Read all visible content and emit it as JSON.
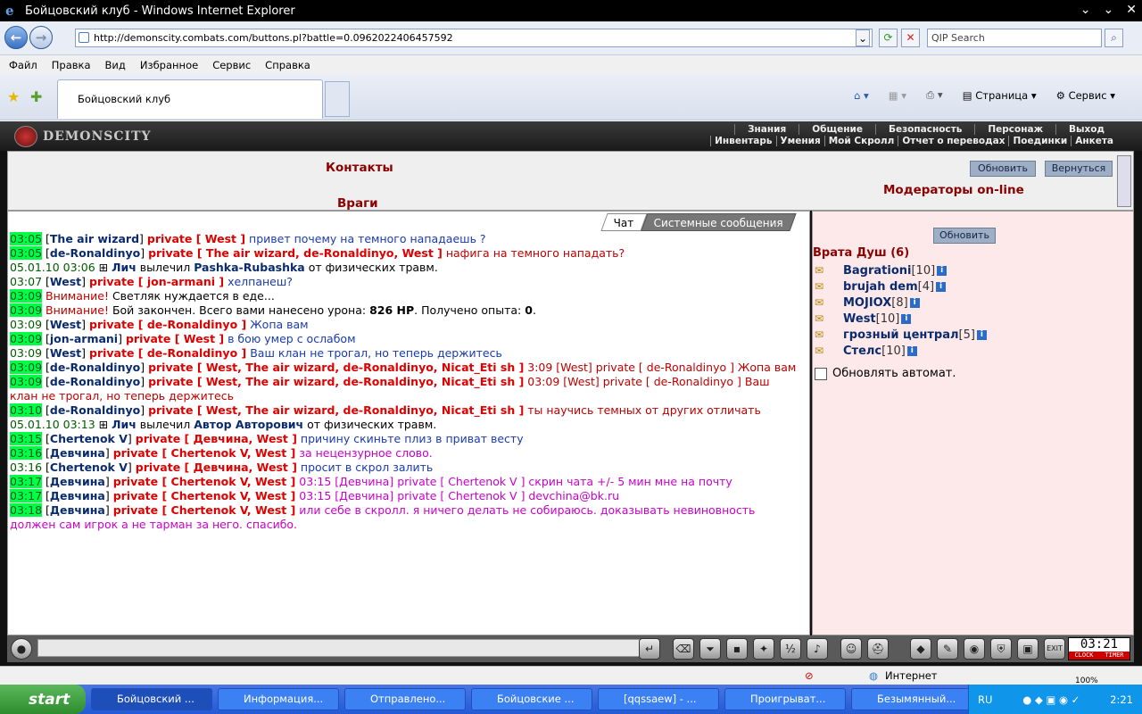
{
  "window": {
    "title": "Бойцовский клуб - Windows Internet Explorer"
  },
  "address": {
    "url": "http://demonscity.combats.com/buttons.pl?battle=0.0962022406457592",
    "search_placeholder": "QIP Search"
  },
  "menu": [
    "Файл",
    "Правка",
    "Вид",
    "Избранное",
    "Сервис",
    "Справка"
  ],
  "tab": {
    "label": "Бойцовский клуб"
  },
  "commands": {
    "page": "Страница",
    "tools": "Сервис"
  },
  "game": {
    "logo": "DEMONSCITY",
    "menu_top": [
      "Знания",
      "Общение",
      "Безопасность",
      "Персонаж",
      "Выход"
    ],
    "menu_bottom": [
      "Инвентарь",
      "Умения",
      "Мой Скролл",
      "Отчет о переводах",
      "Поединки",
      "Анкета"
    ],
    "contacts_title": "Контакты",
    "enemies_title": "Враги",
    "moderators_title": "Модераторы on-line",
    "refresh_label": "Обновить",
    "back_label": "Вернуться",
    "chat_tab": "Чат",
    "system_tab": "Системные сообщения",
    "users_refresh": "Обновить",
    "room": "Врата Душ (6)",
    "auto_refresh": "Обновлять автомат.",
    "clock": "03:21",
    "clock_label1": "CLOCK",
    "clock_label2": "TIMER"
  },
  "chat": [
    [
      {
        "c": "tm",
        "t": "03:05"
      },
      {
        "c": "tk",
        "t": " ["
      },
      {
        "c": "nk",
        "t": "The air wizard"
      },
      {
        "c": "tk",
        "t": "] "
      },
      {
        "c": "pr",
        "t": "private [ West ]"
      },
      {
        "c": "tb",
        "t": " привет почему на темного нападаешь ?"
      }
    ],
    [
      {
        "c": "tm",
        "t": "03:05"
      },
      {
        "c": "tk",
        "t": " ["
      },
      {
        "c": "nk",
        "t": "de-Ronaldinyo"
      },
      {
        "c": "tk",
        "t": "] "
      },
      {
        "c": "pr",
        "t": "private [ The air wizard, de-Ronaldinyo, West ]"
      },
      {
        "c": "tr",
        "t": " нафига на темного нападать?"
      }
    ],
    [
      {
        "c": "tp",
        "t": "05.01.10 03:06"
      },
      {
        "c": "tk",
        "t": " ⊞ "
      },
      {
        "c": "nk",
        "t": "Лич"
      },
      {
        "c": "tk",
        "t": " вылечил "
      },
      {
        "c": "nk",
        "t": "Pashka-Rubashka"
      },
      {
        "c": "tk",
        "t": " от физических травм."
      }
    ],
    [
      {
        "c": "tp",
        "t": "03:07"
      },
      {
        "c": "tk",
        "t": " ["
      },
      {
        "c": "nk",
        "t": "West"
      },
      {
        "c": "tk",
        "t": "] "
      },
      {
        "c": "pr",
        "t": "private [ jon-armani ]"
      },
      {
        "c": "tb",
        "t": " хелпанеш?"
      }
    ],
    [
      {
        "c": "tm",
        "t": "03:09"
      },
      {
        "c": "tr",
        "t": " Внимание!"
      },
      {
        "c": "tk",
        "t": " Светляк нуждается в еде..."
      }
    ],
    [
      {
        "c": "tm",
        "t": "03:09"
      },
      {
        "c": "tr",
        "t": " Внимание!"
      },
      {
        "c": "tk",
        "t": " Бой закончен. Всего вами нанесено урона: "
      },
      {
        "c": "nkb",
        "t": "826 HP"
      },
      {
        "c": "tk",
        "t": ". Получено опыта: "
      },
      {
        "c": "nkb",
        "t": "0"
      },
      {
        "c": "tk",
        "t": "."
      }
    ],
    [
      {
        "c": "tp",
        "t": "03:09"
      },
      {
        "c": "tk",
        "t": " ["
      },
      {
        "c": "nk",
        "t": "West"
      },
      {
        "c": "tk",
        "t": "] "
      },
      {
        "c": "pr",
        "t": "private [ de-Ronaldinyo ]"
      },
      {
        "c": "tb",
        "t": " Жопа вам"
      }
    ],
    [
      {
        "c": "tm",
        "t": "03:09"
      },
      {
        "c": "tk",
        "t": " ["
      },
      {
        "c": "nk",
        "t": "jon-armani"
      },
      {
        "c": "tk",
        "t": "] "
      },
      {
        "c": "pr",
        "t": "private [ West ]"
      },
      {
        "c": "tb",
        "t": " в бою умер с ослабом"
      }
    ],
    [
      {
        "c": "tp",
        "t": "03:09"
      },
      {
        "c": "tk",
        "t": " ["
      },
      {
        "c": "nk",
        "t": "West"
      },
      {
        "c": "tk",
        "t": "] "
      },
      {
        "c": "pr",
        "t": "private [ de-Ronaldinyo ]"
      },
      {
        "c": "tb",
        "t": " Ваш клан не трогал, но теперь держитесь"
      }
    ],
    [
      {
        "c": "tm",
        "t": "03:09"
      },
      {
        "c": "tk",
        "t": " ["
      },
      {
        "c": "nk",
        "t": "de-Ronaldinyo"
      },
      {
        "c": "tk",
        "t": "] "
      },
      {
        "c": "pr",
        "t": "private [ West, The air wizard, de-Ronaldinyo, Nicat_Eti sh ]"
      },
      {
        "c": "tr",
        "t": " 3:09 [West] private [ de-Ronaldinyo ] Жопа вам"
      }
    ],
    [
      {
        "c": "tm",
        "t": "03:09"
      },
      {
        "c": "tk",
        "t": " ["
      },
      {
        "c": "nk",
        "t": "de-Ronaldinyo"
      },
      {
        "c": "tk",
        "t": "] "
      },
      {
        "c": "pr",
        "t": "private [ West, The air wizard, de-Ronaldinyo, Nicat_Eti sh ]"
      },
      {
        "c": "tr",
        "t": " 03:09 [West] private [ de-Ronaldinyo ] Ваш клан не трогал, но теперь держитесь"
      }
    ],
    [
      {
        "c": "tm",
        "t": "03:10"
      },
      {
        "c": "tk",
        "t": " ["
      },
      {
        "c": "nk",
        "t": "de-Ronaldinyo"
      },
      {
        "c": "tk",
        "t": "] "
      },
      {
        "c": "pr",
        "t": "private [ West, The air wizard, de-Ronaldinyo, Nicat_Eti sh ]"
      },
      {
        "c": "tr",
        "t": " ты научись темных от других отличать"
      }
    ],
    [
      {
        "c": "tp",
        "t": "05.01.10 03:13"
      },
      {
        "c": "tk",
        "t": " ⊞ "
      },
      {
        "c": "nk",
        "t": "Лич"
      },
      {
        "c": "tk",
        "t": " вылечил "
      },
      {
        "c": "nk",
        "t": "Автор Авторович"
      },
      {
        "c": "tk",
        "t": " от физических травм."
      }
    ],
    [
      {
        "c": "tm",
        "t": "03:15"
      },
      {
        "c": "tk",
        "t": " ["
      },
      {
        "c": "nk",
        "t": "Chertenok V"
      },
      {
        "c": "tk",
        "t": "] "
      },
      {
        "c": "pr",
        "t": "private [ Девчина, West ]"
      },
      {
        "c": "tb",
        "t": " причину скиньте плиз в приват весту"
      }
    ],
    [
      {
        "c": "tm",
        "t": "03:16"
      },
      {
        "c": "tk",
        "t": " ["
      },
      {
        "c": "nk",
        "t": "Девчина"
      },
      {
        "c": "tk",
        "t": "] "
      },
      {
        "c": "pr",
        "t": "private [ Chertenok V, West ]"
      },
      {
        "c": "tv",
        "t": " за нецензурное слово."
      }
    ],
    [
      {
        "c": "tp",
        "t": "03:16"
      },
      {
        "c": "tk",
        "t": " ["
      },
      {
        "c": "nk",
        "t": "Chertenok V"
      },
      {
        "c": "tk",
        "t": "] "
      },
      {
        "c": "pr",
        "t": "private [ Девчина, West ]"
      },
      {
        "c": "tb",
        "t": " просит в скрол залить"
      }
    ],
    [
      {
        "c": "tm",
        "t": "03:17"
      },
      {
        "c": "tk",
        "t": " ["
      },
      {
        "c": "nk",
        "t": "Девчина"
      },
      {
        "c": "tk",
        "t": "] "
      },
      {
        "c": "pr",
        "t": "private [ Chertenok V, West ]"
      },
      {
        "c": "tv",
        "t": " 03:15 [Девчина] private [ Chertenok V ] скрин чата +/- 5 мин мне на почту"
      }
    ],
    [
      {
        "c": "tm",
        "t": "03:17"
      },
      {
        "c": "tk",
        "t": " ["
      },
      {
        "c": "nk",
        "t": "Девчина"
      },
      {
        "c": "tk",
        "t": "] "
      },
      {
        "c": "pr",
        "t": "private [ Chertenok V, West ]"
      },
      {
        "c": "tv",
        "t": " 03:15 [Девчина] private [ Chertenok V ] devchina@bk.ru"
      }
    ],
    [
      {
        "c": "tm",
        "t": "03:18"
      },
      {
        "c": "tk",
        "t": " ["
      },
      {
        "c": "nk",
        "t": "Девчина"
      },
      {
        "c": "tk",
        "t": "] "
      },
      {
        "c": "pr",
        "t": "private [ Chertenok V, West ]"
      },
      {
        "c": "tv",
        "t": " или себе в скролл. я ничего делать не собираюсь. доказывать невиновность должен сам игрок а не тарман за него. спасибо."
      }
    ]
  ],
  "users": [
    {
      "name": "Bagrationi",
      "level": "[10]"
    },
    {
      "name": "brujah dem",
      "level": "[4]"
    },
    {
      "name": "MOJIOX",
      "level": "[8]"
    },
    {
      "name": "West",
      "level": "[10]"
    },
    {
      "name": "грозный централ",
      "level": "[5]"
    },
    {
      "name": "Стелс",
      "level": "[10]"
    }
  ],
  "status": {
    "zone": "Интернет",
    "zoom": "100%"
  },
  "taskbar": {
    "start": "start",
    "items": [
      "Бойцовский ...",
      "Информация...",
      "Отправлено...",
      "Бойцовские ...",
      "[qqssaew] - ...",
      "Проигрыват...",
      "Безымянный..."
    ],
    "lang": "RU",
    "time": "2:21"
  }
}
